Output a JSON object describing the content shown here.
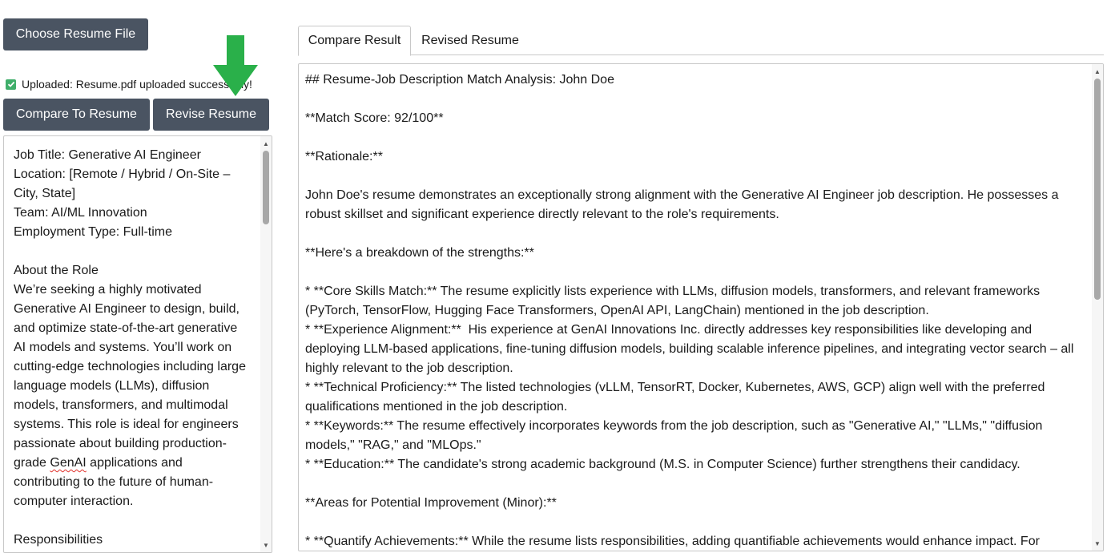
{
  "buttons": {
    "choose_file": "Choose Resume File",
    "compare": "Compare To Resume",
    "revise": "Revise Resume"
  },
  "upload_status": "Uploaded: Resume.pdf uploaded successfully!",
  "job_description": {
    "before_misspelled": "Job Title: Generative AI Engineer\nLocation: [Remote / Hybrid / On-Site –\nCity, State]\nTeam: AI/ML Innovation\nEmployment Type: Full-time\n\nAbout the Role\nWe’re seeking a highly motivated\nGenerative AI Engineer to design, build,\nand optimize state-of-the-art generative\nAI models and systems. You’ll work on\ncutting-edge technologies including large\nlanguage models (LLMs), diffusion\nmodels, transformers, and multimodal\nsystems. This role is ideal for engineers\npassionate about building production-\ngrade ",
    "misspelled_word": "GenAI",
    "after_misspelled": " applications and\ncontributing to the future of human-\ncomputer interaction.\n\nResponsibilities"
  },
  "tabs": [
    {
      "label": "Compare Result",
      "active": true
    },
    {
      "label": "Revised Resume",
      "active": false
    }
  ],
  "compare_result": "## Resume-Job Description Match Analysis: John Doe\n\n**Match Score: 92/100**\n\n**Rationale:**\n\nJohn Doe's resume demonstrates an exceptionally strong alignment with the Generative AI Engineer job description. He possesses a\nrobust skillset and significant experience directly relevant to the role's requirements.\n\n**Here's a breakdown of the strengths:**\n\n* **Core Skills Match:** The resume explicitly lists experience with LLMs, diffusion models, transformers, and relevant frameworks\n(PyTorch, TensorFlow, Hugging Face Transformers, OpenAI API, LangChain) mentioned in the job description.\n* **Experience Alignment:**  His experience at GenAI Innovations Inc. directly addresses key responsibilities like developing and\ndeploying LLM-based applications, fine-tuning diffusion models, building scalable inference pipelines, and integrating vector search – all\nhighly relevant to the job description.\n* **Technical Proficiency:** The listed technologies (vLLM, TensorRT, Docker, Kubernetes, AWS, GCP) align well with the preferred\nqualifications mentioned in the job description.\n* **Keywords:** The resume effectively incorporates keywords from the job description, such as \"Generative AI,\" \"LLMs,\" \"diffusion\nmodels,\" \"RAG,\" and \"MLOps.\"\n* **Education:** The candidate's strong academic background (M.S. in Computer Science) further strengthens their candidacy.\n\n**Areas for Potential Improvement (Minor):**\n\n* **Quantify Achievements:** While the resume lists responsibilities, adding quantifiable achievements would enhance impact. For",
  "colors": {
    "button_bg": "#4a5462",
    "arrow": "#2ab04a",
    "checkbox": "#3fae6a"
  },
  "icons": {
    "checkbox": "checkbox-checked-icon",
    "arrow": "arrow-down-icon"
  }
}
